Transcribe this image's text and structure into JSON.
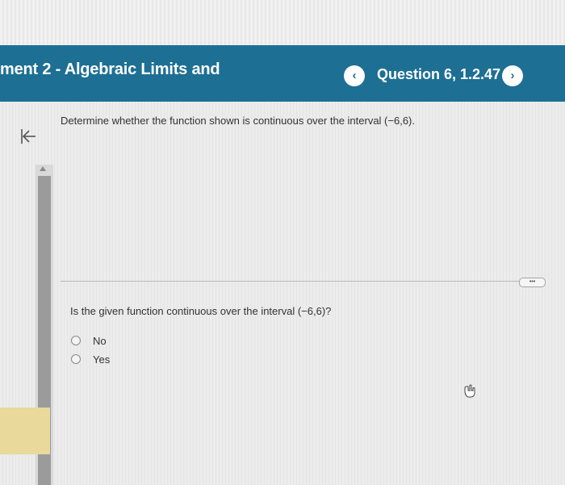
{
  "header": {
    "title": "ment 2 - Algebraic Limits and",
    "prev_glyph": "‹",
    "question_label": "Question 6, 1.2.47",
    "next_glyph": "›",
    "background_color": "#1d6f94"
  },
  "content": {
    "back_icon": "back-arrow-icon",
    "prompt": "Determine whether the function shown is continuous over the interval (−6,6).",
    "more_label": "•••",
    "question": "Is the given function continuous over the interval (−6,6)?",
    "options": [
      {
        "label": "No"
      },
      {
        "label": "Yes"
      }
    ]
  }
}
